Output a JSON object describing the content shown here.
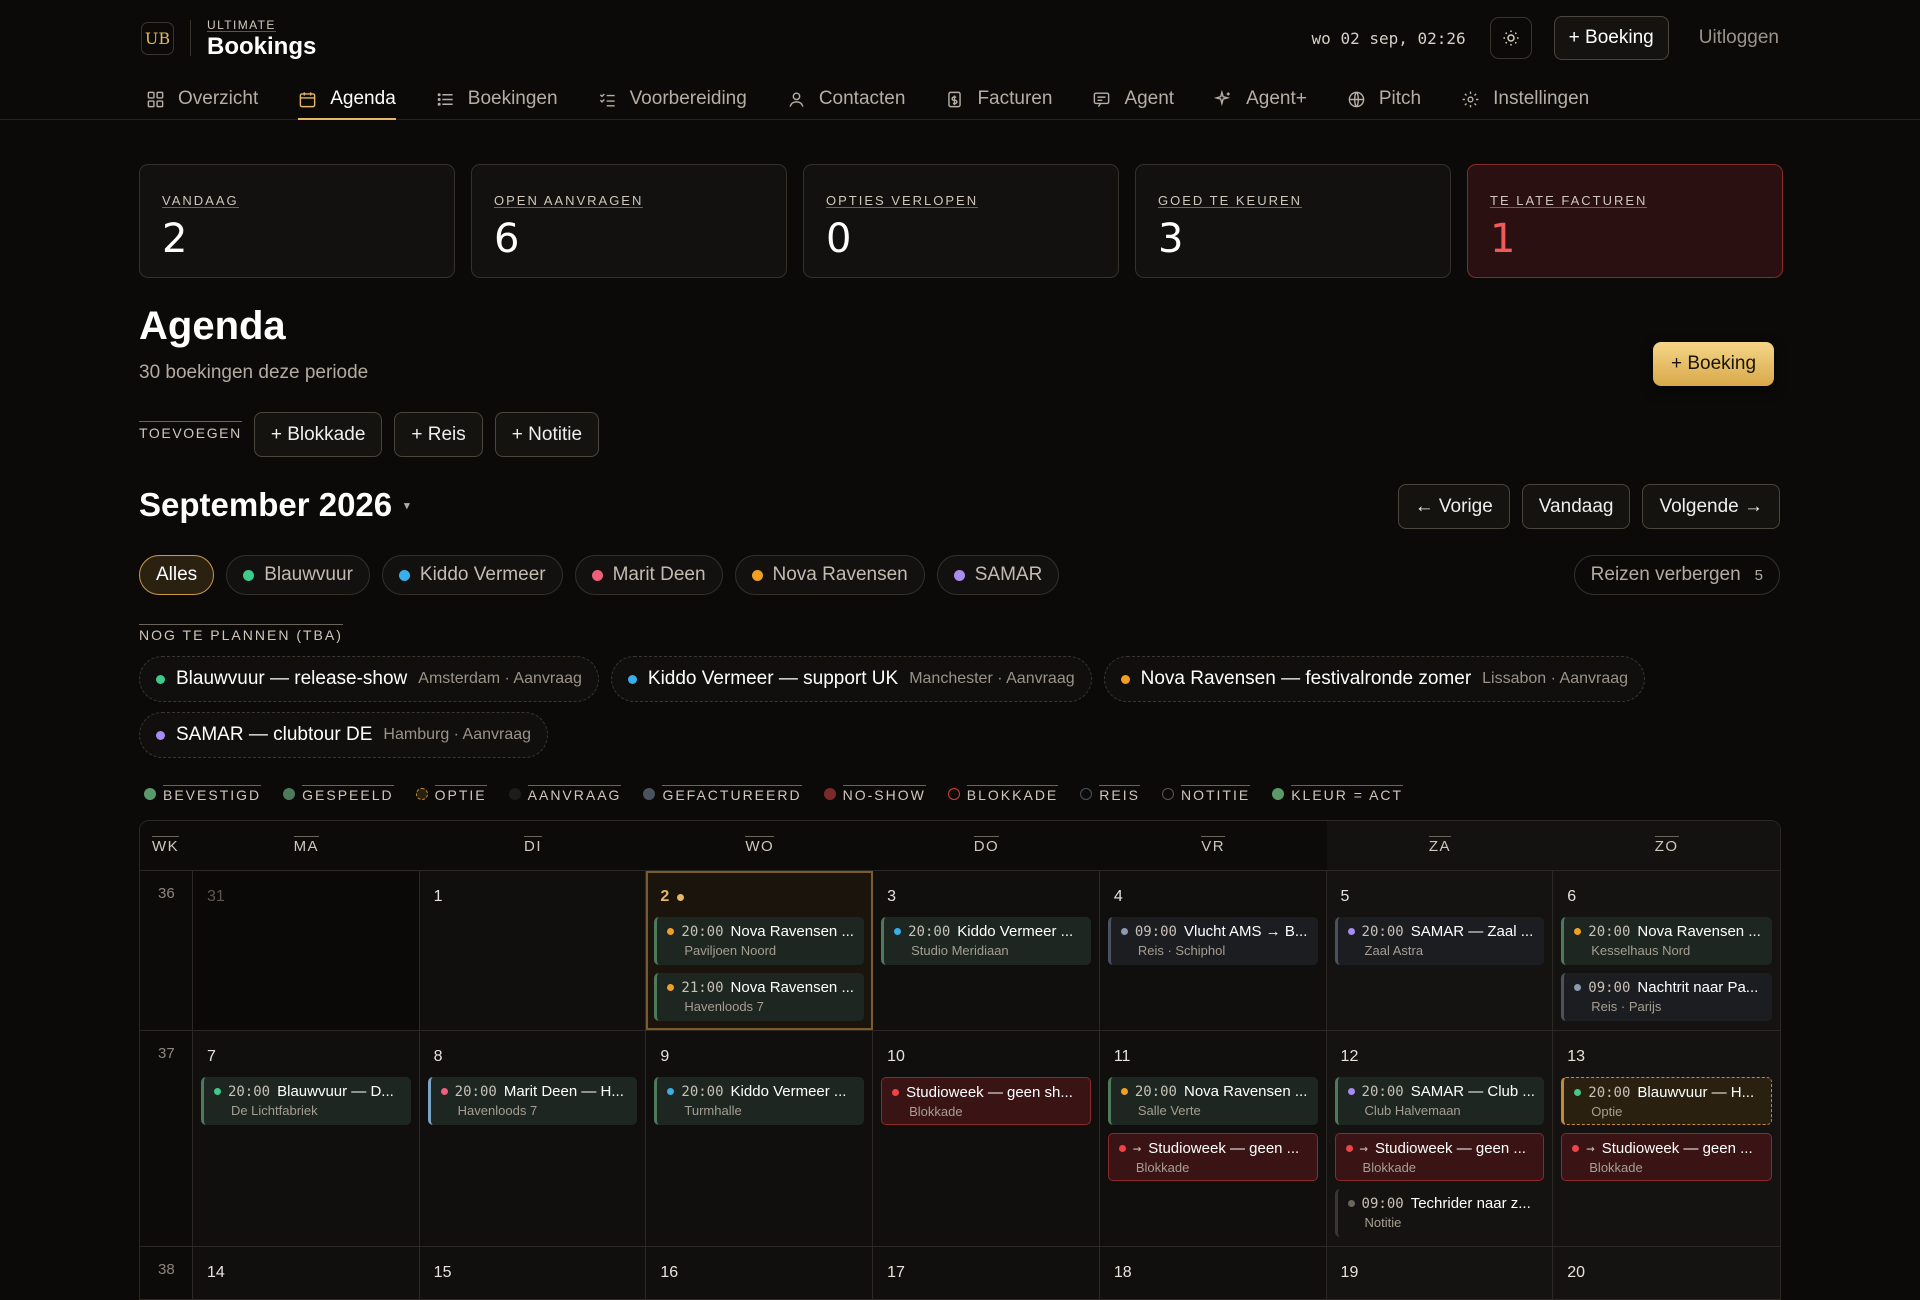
{
  "brand": {
    "small": "ULTIMATE",
    "big": "Bookings",
    "logo": "UB"
  },
  "header": {
    "datetime": "wo 02 sep, 02:26",
    "new_booking": "+ Boeking",
    "logout": "Uitloggen"
  },
  "nav": [
    {
      "label": "Overzicht",
      "icon": "grid-icon"
    },
    {
      "label": "Agenda",
      "icon": "calendar-icon",
      "active": true
    },
    {
      "label": "Boekingen",
      "icon": "list-icon"
    },
    {
      "label": "Voorbereiding",
      "icon": "checklist-icon"
    },
    {
      "label": "Contacten",
      "icon": "person-icon"
    },
    {
      "label": "Facturen",
      "icon": "invoice-icon"
    },
    {
      "label": "Agent",
      "icon": "chat-icon"
    },
    {
      "label": "Agent+",
      "icon": "sparkle-icon"
    },
    {
      "label": "Pitch",
      "icon": "globe-icon"
    },
    {
      "label": "Instellingen",
      "icon": "gear-icon"
    }
  ],
  "kpis": [
    {
      "label": "VANDAAG",
      "value": "2"
    },
    {
      "label": "OPEN AANVRAGEN",
      "value": "6"
    },
    {
      "label": "OPTIES VERLOPEN",
      "value": "0"
    },
    {
      "label": "GOED TE KEUREN",
      "value": "3"
    },
    {
      "label": "TE LATE FACTUREN",
      "value": "1",
      "alert": true
    }
  ],
  "agenda": {
    "title": "Agenda",
    "subtitle": "30 boekingen deze periode",
    "new_booking": "+ Boeking",
    "add_label": "TOEVOEGEN",
    "add_buttons": [
      "+ Blokkade",
      "+ Reis",
      "+ Notitie"
    ]
  },
  "calendar_nav": {
    "month": "September 2026",
    "caret": "▾",
    "prev": "← Vorige",
    "today": "Vandaag",
    "next": "Volgende →"
  },
  "filters": [
    {
      "label": "Alles",
      "active": true
    },
    {
      "label": "Blauwvuur",
      "color": "#3fc98a"
    },
    {
      "label": "Kiddo Vermeer",
      "color": "#3aaee8"
    },
    {
      "label": "Marit Deen",
      "color": "#ef5f7a"
    },
    {
      "label": "Nova Ravensen",
      "color": "#f0a020"
    },
    {
      "label": "SAMAR",
      "color": "#a98cf0"
    }
  ],
  "hide_trips": {
    "label": "Reizen verbergen",
    "count": "5"
  },
  "tba": {
    "label": "NOG TE PLANNEN (TBA)",
    "items": [
      {
        "name": "Blauwvuur — release-show",
        "meta": "Amsterdam · Aanvraag",
        "color": "#3fc98a"
      },
      {
        "name": "Kiddo Vermeer — support UK",
        "meta": "Manchester · Aanvraag",
        "color": "#3aaee8"
      },
      {
        "name": "Nova Ravensen — festivalronde zomer",
        "meta": "Lissabon · Aanvraag",
        "color": "#f0a020"
      },
      {
        "name": "SAMAR — clubtour DE",
        "meta": "Hamburg · Aanvraag",
        "color": "#a98cf0"
      }
    ]
  },
  "legend": [
    {
      "label": "BEVESTIGD",
      "color": "#5a9a6a",
      "style": "fill"
    },
    {
      "label": "GESPEELD",
      "color": "#4d7a5b",
      "style": "fill"
    },
    {
      "label": "OPTIE",
      "color": "#c28a3c",
      "style": "dashed"
    },
    {
      "label": "AANVRAAG",
      "color": "#1e1c19",
      "style": "fill"
    },
    {
      "label": "GEFACTUREERD",
      "color": "#4a5260",
      "style": "fill"
    },
    {
      "label": "NO-SHOW",
      "color": "#7a2a2a",
      "style": "fill"
    },
    {
      "label": "BLOKKADE",
      "color": "#d04040",
      "style": "ring"
    },
    {
      "label": "REIS",
      "color": "#4a5260",
      "style": "ring"
    },
    {
      "label": "NOTITIE",
      "color": "#5a554d",
      "style": "ring"
    },
    {
      "label": "KLEUR = ACT",
      "color": "#5a9a6a",
      "style": "fill"
    }
  ],
  "calendar": {
    "headers": [
      "WK",
      "MA",
      "DI",
      "WO",
      "DO",
      "VR",
      "ZA",
      "ZO"
    ],
    "weeks": [
      {
        "wk": "36",
        "days": [
          {
            "num": "31",
            "dim": true,
            "events": []
          },
          {
            "num": "1",
            "events": []
          },
          {
            "num": "2",
            "today": true,
            "events": [
              {
                "time": "20:00",
                "title": "Nova Ravensen ...",
                "sub": "Paviljoen Noord",
                "color": "#f0a020",
                "kind": "gespeeld"
              },
              {
                "time": "21:00",
                "title": "Nova Ravensen ...",
                "sub": "Havenloods 7",
                "color": "#f0a020",
                "kind": "gespeeld"
              }
            ]
          },
          {
            "num": "3",
            "events": [
              {
                "time": "20:00",
                "title": "Kiddo Vermeer ...",
                "sub": "Studio Meridiaan",
                "color": "#3aaee8",
                "kind": "gespeeld"
              }
            ]
          },
          {
            "num": "4",
            "events": [
              {
                "time": "09:00",
                "title": "Vlucht AMS → B...",
                "sub": "Reis · Schiphol",
                "color": "#8b9ab0",
                "kind": "reis"
              }
            ]
          },
          {
            "num": "5",
            "we": true,
            "events": [
              {
                "time": "20:00",
                "title": "SAMAR — Zaal ...",
                "sub": "Zaal Astra",
                "color": "#a98cf0",
                "kind": "reis"
              }
            ]
          },
          {
            "num": "6",
            "we": true,
            "events": [
              {
                "time": "20:00",
                "title": "Nova Ravensen ...",
                "sub": "Kesselhaus Nord",
                "color": "#f0a020",
                "kind": "gespeeld"
              },
              {
                "time": "09:00",
                "title": "Nachtrit naar Pa...",
                "sub": "Reis · Parijs",
                "color": "#8b9ab0",
                "kind": "reis"
              }
            ]
          }
        ]
      },
      {
        "wk": "37",
        "days": [
          {
            "num": "7",
            "events": [
              {
                "time": "20:00",
                "title": "Blauwvuur — D...",
                "sub": "De Lichtfabriek",
                "color": "#3fc98a",
                "kind": "gespeeld"
              }
            ]
          },
          {
            "num": "8",
            "events": [
              {
                "time": "20:00",
                "title": "Marit Deen — H...",
                "sub": "Havenloods 7",
                "color": "#ef5f7a",
                "kind": "sel"
              }
            ]
          },
          {
            "num": "9",
            "events": [
              {
                "time": "20:00",
                "title": "Kiddo Vermeer ...",
                "sub": "Turmhalle",
                "color": "#3aaee8",
                "kind": "gespeeld"
              }
            ]
          },
          {
            "num": "10",
            "events": [
              {
                "time": "",
                "title": "Studioweek — geen sh...",
                "sub": "Blokkade",
                "color": "#ef4444",
                "kind": "blok"
              }
            ]
          },
          {
            "num": "11",
            "events": [
              {
                "time": "20:00",
                "title": "Nova Ravensen ...",
                "sub": "Salle Verte",
                "color": "#f0a020",
                "kind": "gespeeld"
              },
              {
                "time": "→",
                "title": "Studioweek — geen ...",
                "sub": "Blokkade",
                "color": "#ef4444",
                "kind": "blok"
              }
            ]
          },
          {
            "num": "12",
            "we": true,
            "events": [
              {
                "time": "20:00",
                "title": "SAMAR — Club ...",
                "sub": "Club Halvemaan",
                "color": "#a98cf0",
                "kind": "gespeeld"
              },
              {
                "time": "→",
                "title": "Studioweek — geen ...",
                "sub": "Blokkade",
                "color": "#ef4444",
                "kind": "blok"
              },
              {
                "time": "09:00",
                "title": "Techrider naar z...",
                "sub": "Notitie",
                "color": "#6a655d",
                "kind": "notitie"
              }
            ]
          },
          {
            "num": "13",
            "we": true,
            "events": [
              {
                "time": "20:00",
                "title": "Blauwvuur — H...",
                "sub": "Optie",
                "color": "#3fc98a",
                "kind": "optie"
              },
              {
                "time": "→",
                "title": "Studioweek — geen ...",
                "sub": "Blokkade",
                "color": "#ef4444",
                "kind": "blok"
              }
            ]
          }
        ]
      },
      {
        "wk": "38",
        "days": [
          {
            "num": "14",
            "events": []
          },
          {
            "num": "15",
            "events": []
          },
          {
            "num": "16",
            "events": []
          },
          {
            "num": "17",
            "events": []
          },
          {
            "num": "18",
            "events": []
          },
          {
            "num": "19",
            "we": true,
            "events": []
          },
          {
            "num": "20",
            "we": true,
            "events": []
          }
        ]
      }
    ]
  }
}
